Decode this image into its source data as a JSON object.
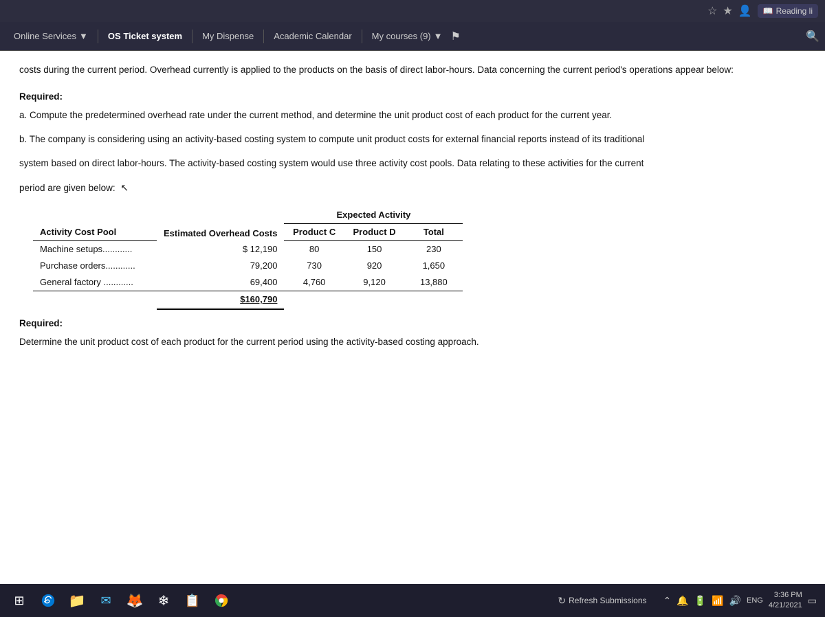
{
  "browser": {
    "url": "view.php?id=28124",
    "reading_label": "Reading li",
    "reading_icon": "📖"
  },
  "navbar": {
    "items": [
      {
        "id": "online-services",
        "label": "Online Services",
        "has_dropdown": true
      },
      {
        "id": "os-ticket",
        "label": "OS Ticket system",
        "has_dropdown": false
      },
      {
        "id": "my-dispense",
        "label": "My Dispense",
        "has_dropdown": false
      },
      {
        "id": "academic-calendar",
        "label": "Academic Calendar",
        "has_dropdown": false
      },
      {
        "id": "my-courses",
        "label": "My courses (9)",
        "has_dropdown": true
      }
    ]
  },
  "content": {
    "intro": "costs during the current period. Overhead currently is applied to the products on the basis of direct labor-hours. Data concerning the current period's operations appear below:",
    "required_label": "Required:",
    "question_a": "a. Compute the predetermined overhead rate under the current method, and determine the unit product cost of each product for the current year.",
    "question_b_line1": "b. The company is considering using an activity-based costing system to compute unit product costs for external financial reports instead of its traditional",
    "question_b_line2": "system based on direct labor-hours. The activity-based costing system would use three activity cost pools. Data relating to these activities for the current",
    "question_b_line3": "period are given below:",
    "table": {
      "col_headers": {
        "activity_cost_pool": "Activity Cost Pool",
        "estimated_overhead": "Estimated Overhead Costs",
        "expected_activity": "Expected Activity",
        "product_c": "Product C",
        "product_d": "Product D",
        "total": "Total"
      },
      "rows": [
        {
          "name": "Machine setups............",
          "cost": "$ 12,190",
          "product_c": "80",
          "product_d": "150",
          "total": "230"
        },
        {
          "name": "Purchase orders............",
          "cost": "79,200",
          "product_c": "730",
          "product_d": "920",
          "total": "1,650"
        },
        {
          "name": "General factory ............",
          "cost": "69,400",
          "product_c": "4,760",
          "product_d": "9,120",
          "total": "13,880"
        }
      ],
      "total_row": {
        "cost": "$160,790"
      }
    },
    "required_label2": "Required:",
    "question_c": "Determine the unit product cost of each product for the current period using the activity-based costing approach."
  },
  "bottom_bar": {
    "refresh_label": "Refresh Submissions",
    "time": "3:36 PM",
    "date": "4/21/2021",
    "eng_label": "ENG"
  },
  "taskbar_icons": [
    {
      "id": "file-explorer",
      "symbol": "⊞"
    },
    {
      "id": "edge-browser",
      "symbol": "🌀"
    },
    {
      "id": "files",
      "symbol": "📁"
    },
    {
      "id": "mail",
      "symbol": "✉"
    },
    {
      "id": "firefox",
      "symbol": "🦊"
    },
    {
      "id": "snowflake",
      "symbol": "❄"
    },
    {
      "id": "teams",
      "symbol": "📋"
    },
    {
      "id": "chrome",
      "symbol": "🔵"
    }
  ]
}
